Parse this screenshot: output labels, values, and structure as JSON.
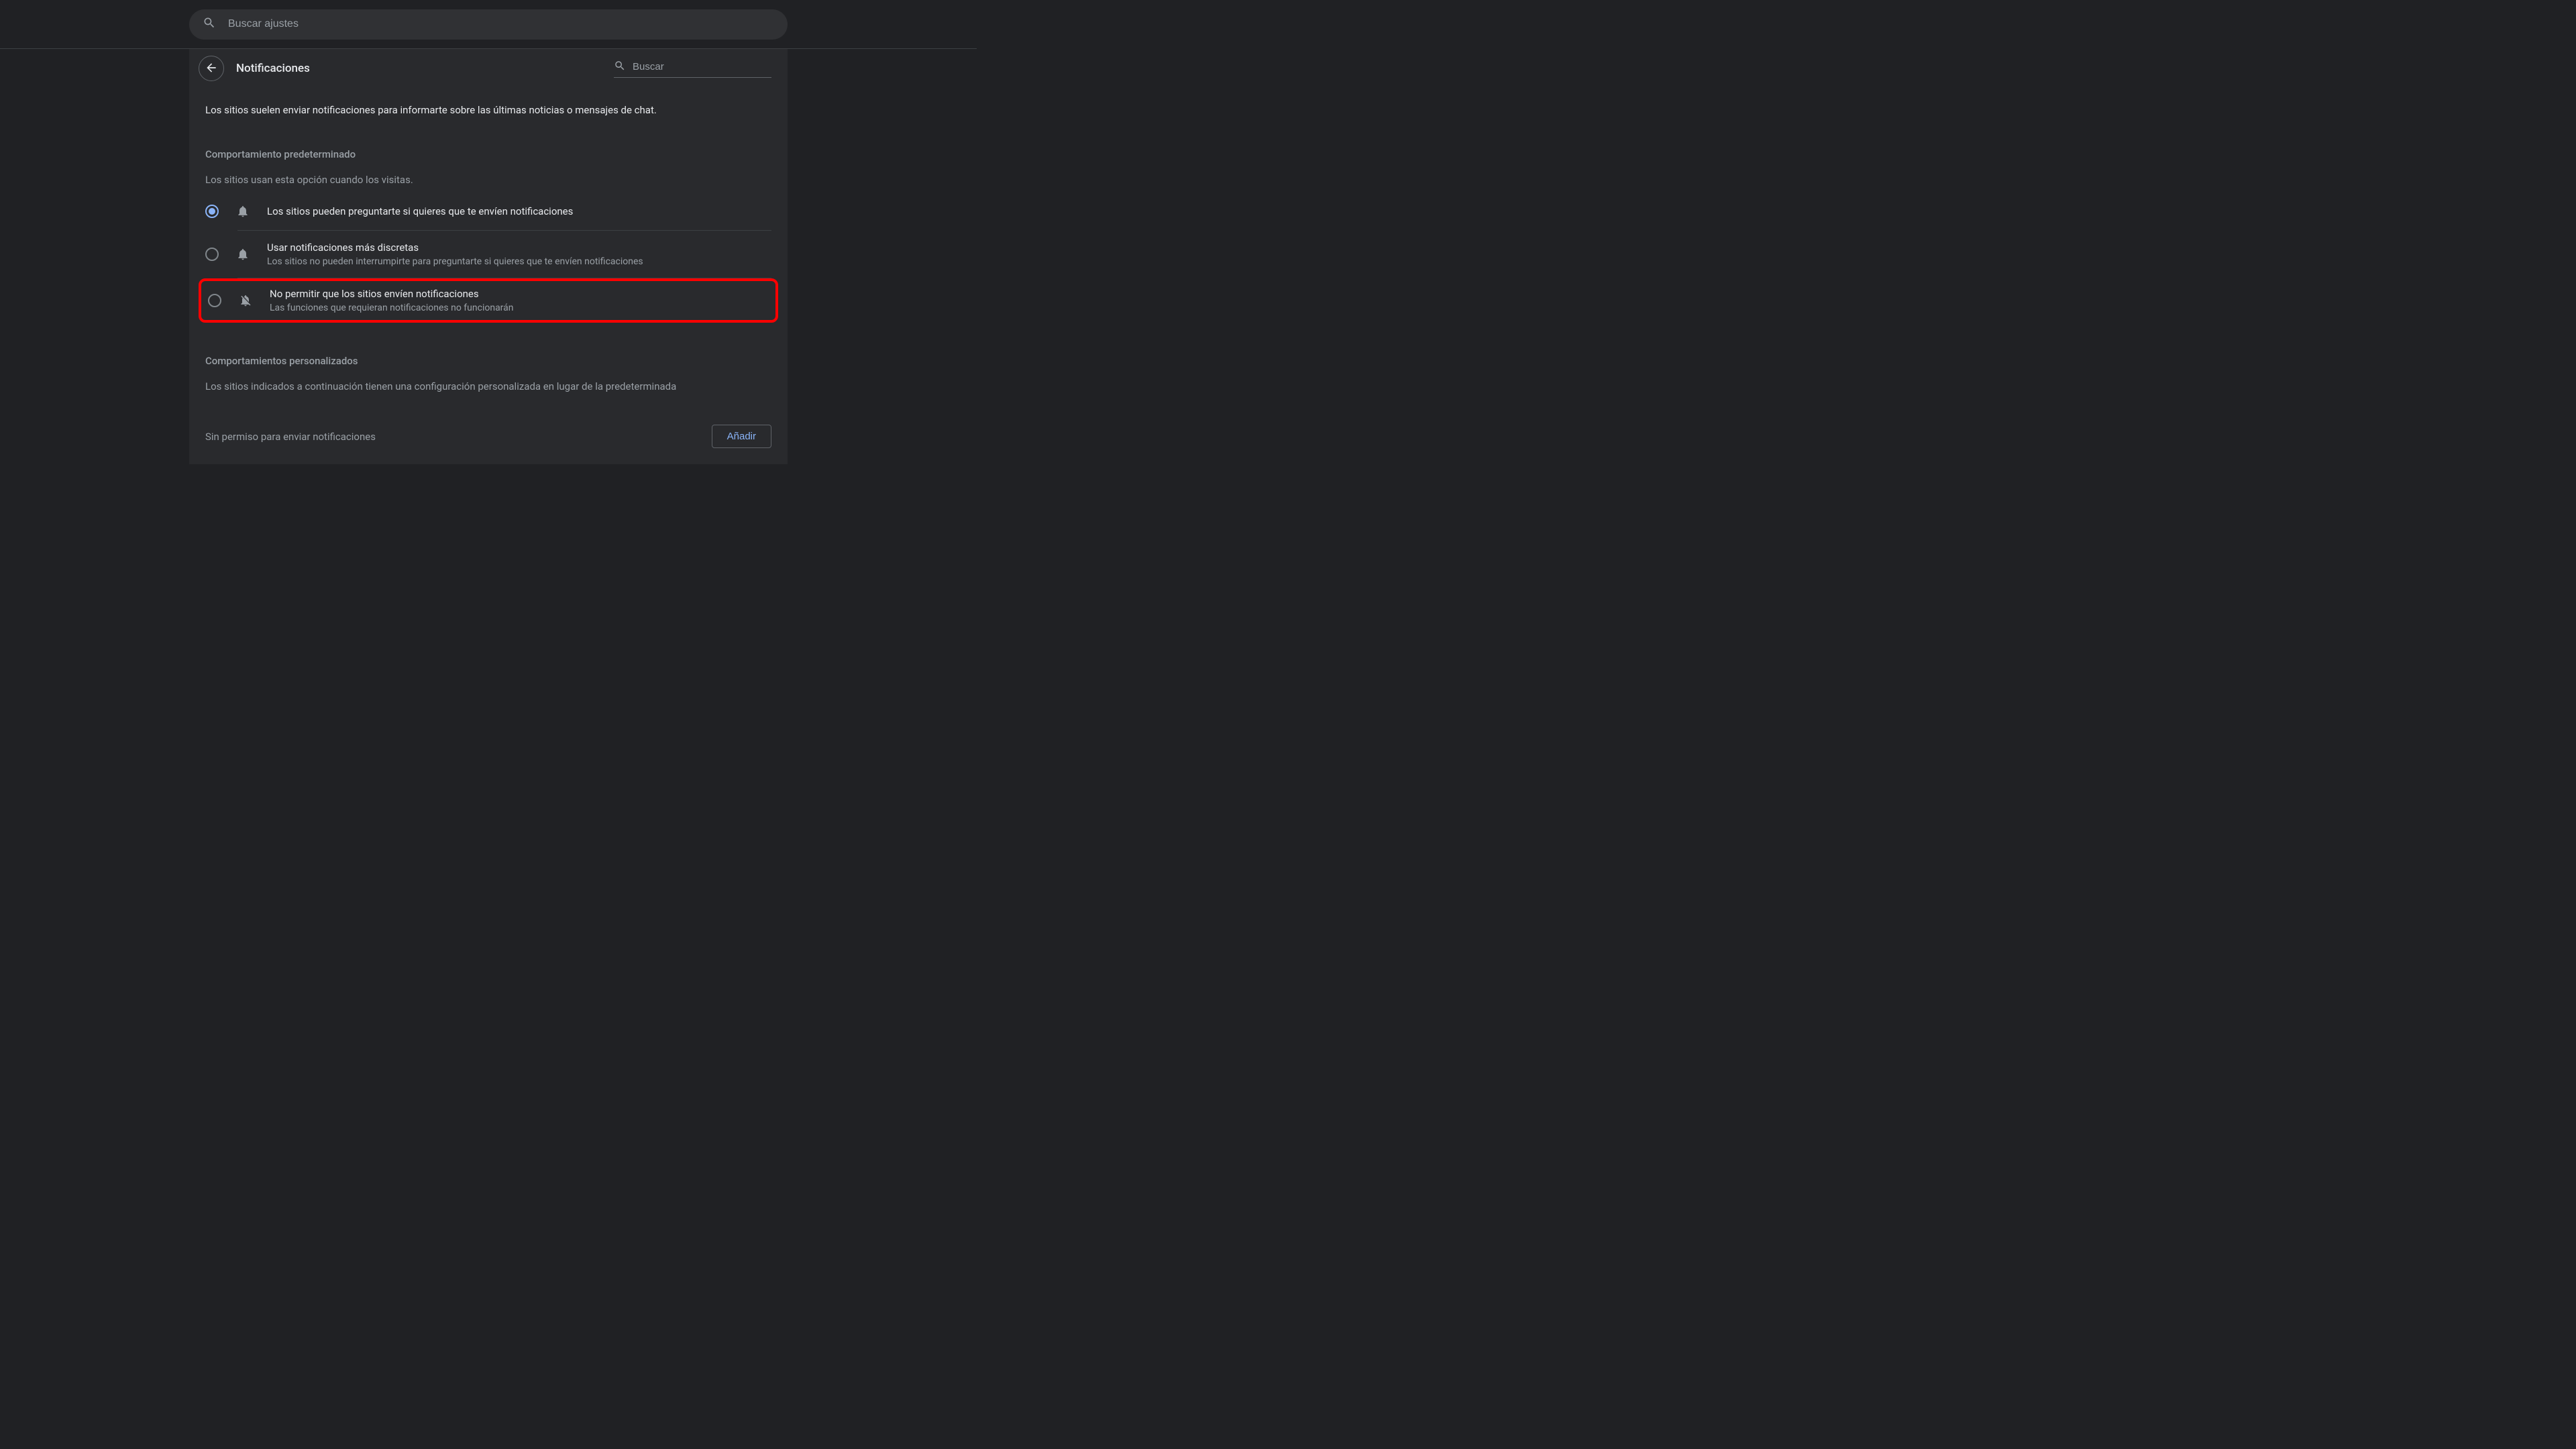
{
  "top_search": {
    "placeholder": "Buscar ajustes"
  },
  "header": {
    "title": "Notificaciones",
    "search_placeholder": "Buscar"
  },
  "description": "Los sitios suelen enviar notificaciones para informarte sobre las últimas noticias o mensajes de chat.",
  "default_behavior": {
    "title": "Comportamiento predeterminado",
    "subtitle": "Los sitios usan esta opción cuando los visitas.",
    "options": [
      {
        "label": "Los sitios pueden preguntarte si quieres que te envíen notificaciones",
        "description": "",
        "selected": true,
        "icon": "bell"
      },
      {
        "label": "Usar notificaciones más discretas",
        "description": "Los sitios no pueden interrumpirte para preguntarte si quieres que te envíen notificaciones",
        "selected": false,
        "icon": "bell"
      },
      {
        "label": "No permitir que los sitios envíen notificaciones",
        "description": "Las funciones que requieran notificaciones no funcionarán",
        "selected": false,
        "icon": "bell-off",
        "highlighted": true
      }
    ]
  },
  "custom_behavior": {
    "title": "Comportamientos personalizados",
    "description": "Los sitios indicados a continuación tienen una configuración personalizada en lugar de la predeterminada",
    "blocked_label": "Sin permiso para enviar notificaciones",
    "add_button": "Añadir"
  }
}
